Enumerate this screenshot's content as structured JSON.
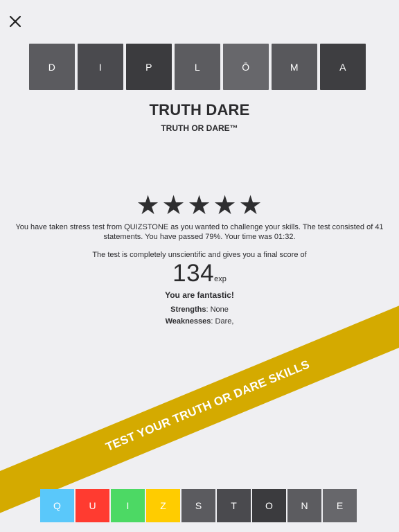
{
  "header": {
    "close_icon": "close-icon"
  },
  "diploma_tiles": [
    {
      "letter": "D",
      "color": "#5b5b5f"
    },
    {
      "letter": "I",
      "color": "#4a4a4e"
    },
    {
      "letter": "P",
      "color": "#3b3b3e"
    },
    {
      "letter": "L",
      "color": "#5c5c60"
    },
    {
      "letter": "Ō",
      "color": "#67676b"
    },
    {
      "letter": "M",
      "color": "#58585c"
    },
    {
      "letter": "A",
      "color": "#3e3e41"
    }
  ],
  "title": "TRUTH DARE",
  "subtitle": "TRUTH OR DARE™",
  "rating": {
    "stars": 5,
    "max": 5,
    "glyph": "★"
  },
  "summary": "You have taken stress test from QUIZSTONE as you wanted to challenge your skills. The test consisted of 41 statements. You have passed 79%. Your time was 01:32.",
  "disclaimer": "The test is completely unscientific and gives you a final score of",
  "score": {
    "value": "134",
    "unit": "exp"
  },
  "verdict": "You are fantastic!",
  "strengths": {
    "label": "Strengths",
    "value": ": None"
  },
  "weaknesses": {
    "label": "Weaknesses",
    "value": ": Dare,"
  },
  "banner": {
    "text": "TEST YOUR TRUTH OR DARE SKILLS",
    "color": "#d4aa00"
  },
  "quiz_tiles": [
    {
      "letter": "Q",
      "color": "#5ac8fa"
    },
    {
      "letter": "U",
      "color": "#ff3b30"
    },
    {
      "letter": "I",
      "color": "#4cd964"
    },
    {
      "letter": "Z",
      "color": "#ffcc00"
    },
    {
      "letter": "S",
      "color": "#5b5b5f"
    },
    {
      "letter": "T",
      "color": "#4a4a4e"
    },
    {
      "letter": "O",
      "color": "#3b3b3e"
    },
    {
      "letter": "N",
      "color": "#5c5c60"
    },
    {
      "letter": "E",
      "color": "#67676b"
    }
  ]
}
